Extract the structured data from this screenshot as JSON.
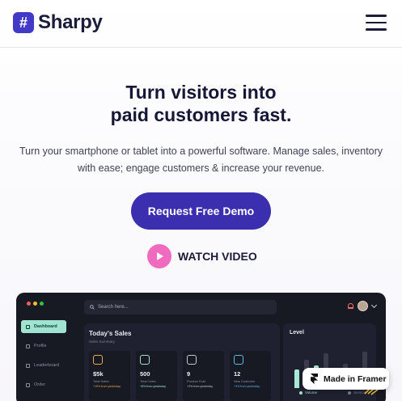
{
  "brand": {
    "mark": "#",
    "name": "Sharpy",
    "accent": "#4339c9"
  },
  "hero": {
    "title_line1": "Turn visitors into",
    "title_line2": "paid customers fast.",
    "subtitle_line1": "Turn your smartphone or tablet into a powerful software. Manage sales, inventory",
    "subtitle_line2": "with ease; engage customers & increase your revenue.",
    "cta_label": "Request Free Demo",
    "cta_color": "#3b2fb0",
    "watch_label": "WATCH VIDEO",
    "play_color": "#f06bbf"
  },
  "dashboard": {
    "search_placeholder": "Search here...",
    "sidebar": [
      "Dashboard",
      "Profile",
      "Leaderboard",
      "Order"
    ],
    "sales": {
      "title": "Today's Sales",
      "subtitle": "Sales Summary",
      "cards": [
        {
          "value": "$5k",
          "label": "Total Sales",
          "change": "+10% from yesterday",
          "color": "#f0a84d"
        },
        {
          "value": "500",
          "label": "Total Order",
          "change": "+8% from yesterday",
          "color": "#9fe3d0"
        },
        {
          "value": "9",
          "label": "Product Sold",
          "change": "+2% from yesterday",
          "color": "#c6c8d4"
        },
        {
          "value": "12",
          "label": "New Customer",
          "change": "+3% from yesterday",
          "color": "#5fb6f0"
        }
      ]
    },
    "level": {
      "title": "Level",
      "legend": [
        "Volume",
        "Service"
      ],
      "bars": [
        {
          "v": 0.45,
          "hi": true
        },
        {
          "v": 0.7,
          "hi": false
        },
        {
          "v": 0.55,
          "hi": true
        },
        {
          "v": 0.85,
          "hi": false
        },
        {
          "v": 0.4,
          "hi": true
        },
        {
          "v": 0.6,
          "hi": false
        },
        {
          "v": 0.5,
          "hi": true
        },
        {
          "v": 0.9,
          "hi": false
        },
        {
          "v": 0.35,
          "hi": true
        }
      ]
    }
  },
  "badge": {
    "label": "Made in Framer"
  }
}
